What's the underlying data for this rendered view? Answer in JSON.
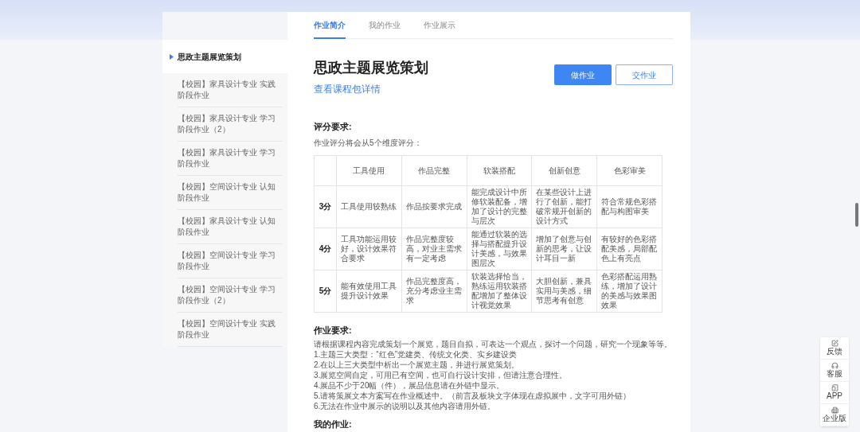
{
  "sidebar": {
    "items": [
      {
        "label": "思政主题展览策划",
        "selected": true
      },
      {
        "label": "【校园】家具设计专业 实践阶段作业",
        "selected": false
      },
      {
        "label": "【校园】家具设计专业 学习阶段作业（2）",
        "selected": false
      },
      {
        "label": "【校园】家具设计专业 学习阶段作业",
        "selected": false
      },
      {
        "label": "【校园】空间设计专业 认知阶段作业",
        "selected": false
      },
      {
        "label": "【校园】家具设计专业 认知阶段作业",
        "selected": false
      },
      {
        "label": "【校园】空间设计专业 学习阶段作业",
        "selected": false
      },
      {
        "label": "【校园】空间设计专业 学习阶段作业（2）",
        "selected": false
      },
      {
        "label": "【校园】空间设计专业 实践阶段作业",
        "selected": false
      }
    ]
  },
  "tabs": [
    {
      "label": "作业简介",
      "selected": true
    },
    {
      "label": "我的作业",
      "selected": false
    },
    {
      "label": "作业展示",
      "selected": false
    }
  ],
  "title": "思政主题展览策划",
  "course_link": "查看课程包详情",
  "buttons": [
    {
      "label": "做作业",
      "kind": "primary"
    },
    {
      "label": "交作业",
      "kind": "outline"
    }
  ],
  "grading": {
    "heading": "评分要求:",
    "intro": "作业评分将会从5个维度评分：",
    "table": {
      "columns": [
        "工具使用",
        "作品完整",
        "软装搭配",
        "创新创意",
        "色彩审美"
      ],
      "rows": [
        {
          "score": "3分",
          "cells": [
            "工具使用较熟练",
            "作品按要求完成",
            "能完成设计中所修软装配备，增加了设计的完整与层次",
            "在某些设计上进行了创新，能打破常规开创新的设计方式",
            "符合常规色彩搭配与构图审美"
          ]
        },
        {
          "score": "4分",
          "cells": [
            "工具功能运用较好，设计效果符合要求",
            "作品完整度较高，对业主需求有一定考虑",
            "能通过软装的选择与搭配提升设计美感，与效果图层次",
            "增加了创意与创新的思考，让设计耳目一新",
            "有较好的色彩搭配美感，局部配色上有亮点"
          ]
        },
        {
          "score": "5分",
          "cells": [
            "能有效使用工具提升设计效果",
            "作品完整度高，充分考虑业主需求",
            "软装选择恰当，熟练运用软装搭配增加了整体设计视觉效果",
            "大胆创新，兼具实用与美感，细节思考有创意",
            "色彩搭配运用熟练，增加了设计的美感与效果图效果"
          ]
        }
      ]
    }
  },
  "requirements": {
    "heading": "作业要求:",
    "lines": [
      "请根据课程内容完成策划一个展览，题目自拟，可表达一个观点，探讨一个问题，研究一个现象等等。",
      "1.主题三大类型：“红色”党建类、传统文化类、实乡建设类",
      "2.在以上三大类型中析出一个展览主题，并进行展览策划。",
      "3.展览空间自定，可用已有空间，也可自行设计安排，但请注意合理性。",
      "4.展品不少于20幅（件），展品信息请在外链中显示。",
      "5.请将策展文本方案写在作业概述中。（前言及板块文字体现在虚拟展中，文字可用外链）",
      "6.无法在作业中展示的说明以及其他内容请用外链。"
    ]
  },
  "my_work_heading": "我的作业:",
  "float_panel": [
    {
      "label": "反馈",
      "kind": "feedback"
    },
    {
      "label": "客服",
      "kind": "service"
    },
    {
      "label": "APP",
      "kind": "app"
    },
    {
      "label": "企业版",
      "kind": "enterprise"
    }
  ]
}
